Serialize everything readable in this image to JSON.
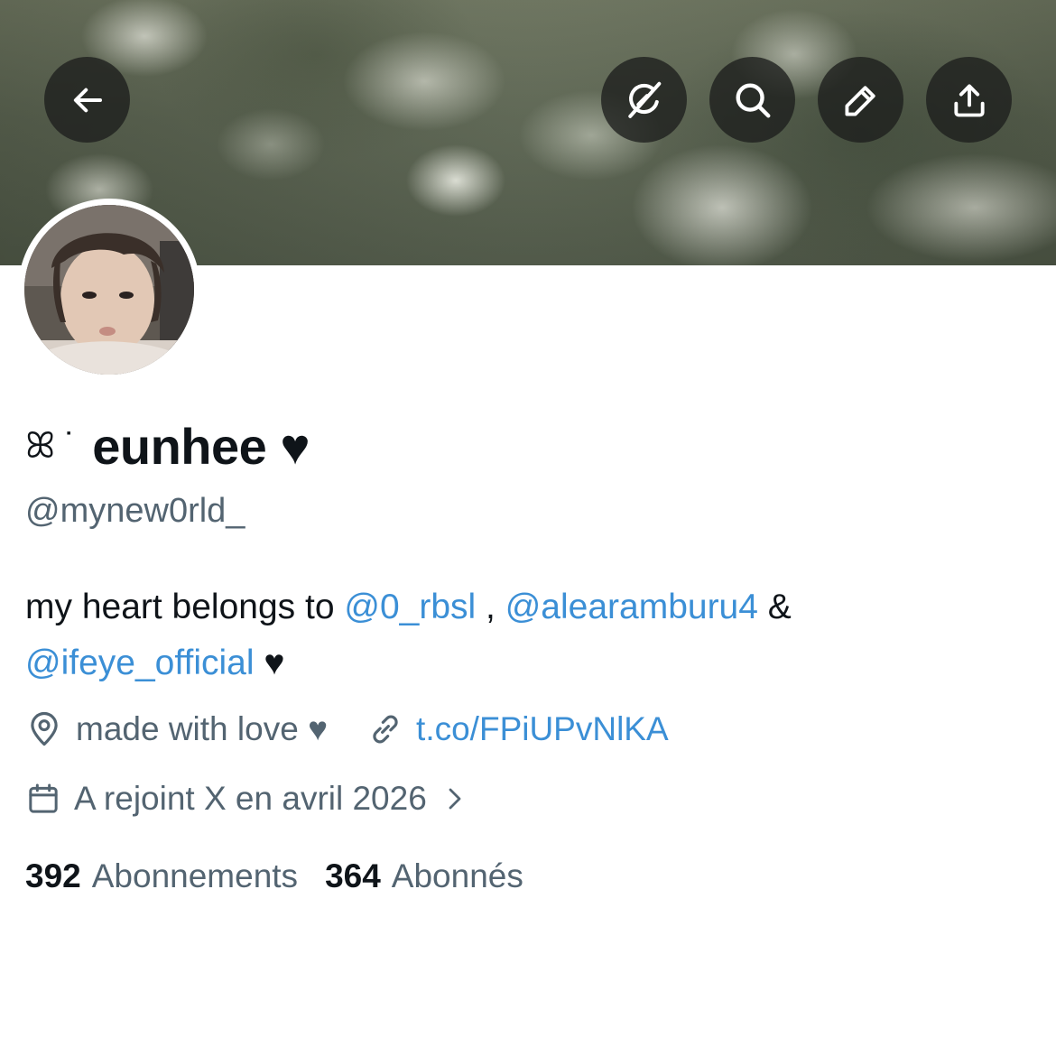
{
  "header": {
    "back_label": "Back",
    "grok_label": "Grok",
    "search_label": "Search",
    "edit_label": "Edit",
    "share_label": "Share"
  },
  "profile": {
    "name_prefix": "ꕤ ˙",
    "display_name": "eunhee ♥",
    "handle": "@mynew0rld_",
    "bio": {
      "intro": "my heart belongs to ",
      "mention_1": "@0_rbsl",
      "sep_1": " , ",
      "mention_2": "@alearamburu4",
      "sep_2": " & ",
      "mention_3": "@ifeye_official",
      "outro": " ♥"
    },
    "location": "made with love ♥",
    "link": "t.co/FPiUPvNlKA",
    "joined": "A rejoint X en avril 2026"
  },
  "stats": {
    "following_count": "392",
    "following_label": "Abonnements",
    "followers_count": "364",
    "followers_label": "Abonnés"
  },
  "colors": {
    "text_primary": "#0f1419",
    "text_secondary": "#536471",
    "link": "#3b8fd6",
    "header_button_bg": "rgba(28,30,28,0.78)"
  },
  "icons": {
    "back": "arrow-left-icon",
    "grok": "grok-icon",
    "search": "search-icon",
    "edit": "pencil-icon",
    "share": "share-icon",
    "location": "location-pin-icon",
    "link": "link-icon",
    "calendar": "calendar-icon",
    "chevron": "chevron-right-icon"
  }
}
